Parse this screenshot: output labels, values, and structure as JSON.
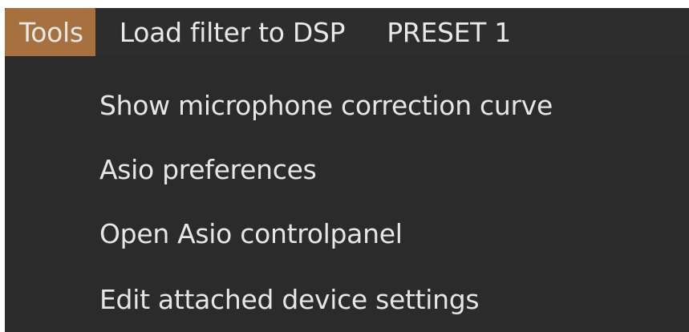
{
  "menubar": {
    "tools_label": "Tools",
    "load_filter_label": "Load filter to DSP",
    "preset_label": "PRESET 1"
  },
  "tools_menu": {
    "items": [
      {
        "label": "Show microphone correction curve"
      },
      {
        "label": "Asio preferences"
      },
      {
        "label": "Open Asio controlpanel"
      },
      {
        "label": "Edit attached device settings"
      }
    ]
  },
  "colors": {
    "menubar_bg": "#2d2d2d",
    "active_menu_bg": "#a6703f",
    "dropdown_bg": "#2b2b2b",
    "text": "#e8e8e8"
  }
}
